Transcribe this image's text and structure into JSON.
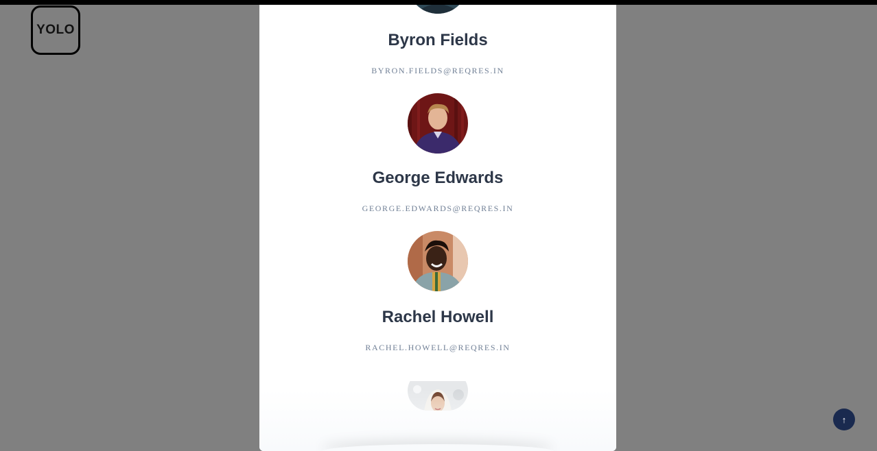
{
  "logo": {
    "text": "YOLO"
  },
  "users": [
    {
      "name": "Byron Fields",
      "email": "BYRON.FIELDS@REQRES.IN"
    },
    {
      "name": "George Edwards",
      "email": "GEORGE.EDWARDS@REQRES.IN"
    },
    {
      "name": "Rachel Howell",
      "email": "RACHEL.HOWELL@REQRES.IN"
    }
  ],
  "scroll_top": {
    "icon": "arrow-up-icon",
    "glyph": "↑"
  },
  "colors": {
    "backdrop": "#808080",
    "panel": "#ffffff",
    "name": "#2d3748",
    "email": "#718096",
    "scroll_button": "#1a2a4f"
  }
}
